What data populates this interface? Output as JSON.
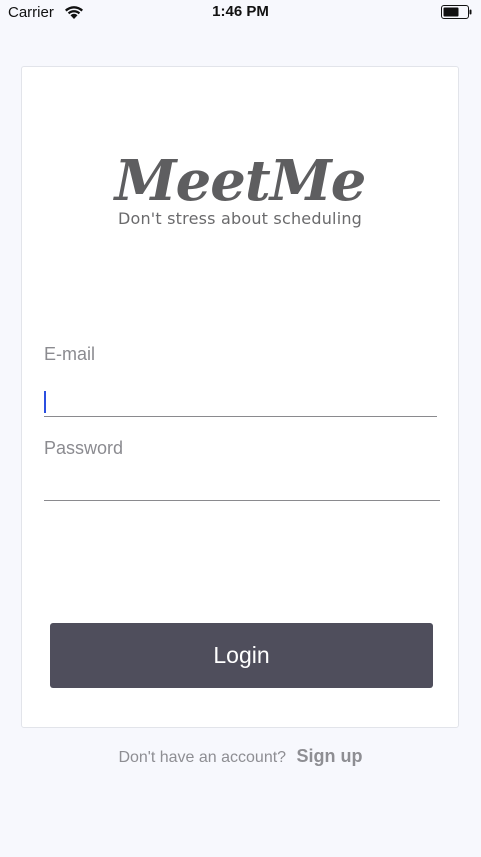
{
  "status_bar": {
    "carrier": "Carrier",
    "time": "1:46 PM"
  },
  "logo": {
    "wordmark": "MeetMe",
    "tagline": "Don't stress about scheduling"
  },
  "form": {
    "email_label": "E-mail",
    "email_value": "",
    "password_label": "Password",
    "password_value": "",
    "login_label": "Login"
  },
  "footer": {
    "prompt": "Don't have an account?",
    "signup_label": "Sign up"
  },
  "colors": {
    "background": "#f7f8fd",
    "button": "#4f4e5c",
    "caret": "#2b4fe0"
  }
}
